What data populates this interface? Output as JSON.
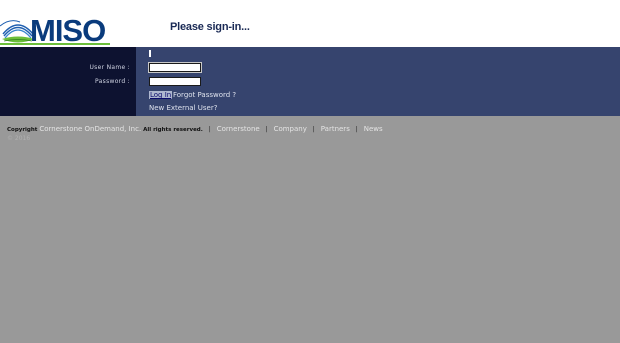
{
  "header": {
    "logo_text": "MISO",
    "title": "Please sign-in..."
  },
  "form": {
    "username_label": "User Name :",
    "password_label": "Password :",
    "username_value": "",
    "password_value": "",
    "login_link": "Log In",
    "forgot_link": "Forgot Password ?",
    "new_user_link": "New External User?"
  },
  "footer": {
    "copyright_label": "Copyright",
    "company_link": "Cornerstone OnDemand, Inc.",
    "rights_text": "All rights reserved.",
    "sep": "|",
    "links": [
      "Cornerstone",
      "Company",
      "Partners",
      "News"
    ],
    "line2": "© 2016"
  },
  "colors": {
    "page_bg": "#999999",
    "left_panel": "#0d1230",
    "right_panel": "#36446e",
    "logo_blue": "#0a3b7c",
    "logo_green": "#6cbf3a"
  }
}
